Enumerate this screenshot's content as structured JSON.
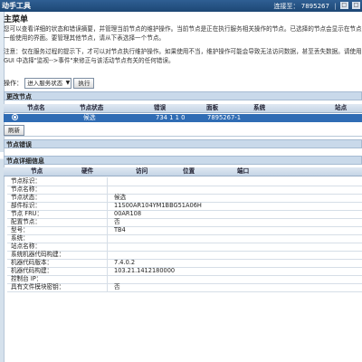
{
  "header": {
    "title_fragment": "动手工具",
    "connection_label": "连接至：",
    "connection_id": "7895267",
    "separator": "|",
    "window_buttons": [
      "□",
      "□"
    ]
  },
  "main_menu": {
    "title": "主菜单",
    "description": "您可以查看详细的状态和错误摘要，并管理当前节点的维护操作。当前节点是正在执行服务相关操作的节点。已选择的节点会显示在节点一般使用的界面。要管理其他节点，请从下表选择一个节点。",
    "note": "注意：仅在服务过程的提示下，才可以对节点执行维护操作。如果使用不当，维护操作可能会导致无法访问数据，甚至丢失数据。请使用 GUI 中选择\"监视-->事件\"来修正与该活动节点有关的任何错误。"
  },
  "operation": {
    "label": "操作：",
    "selected": "进入服务状态",
    "execute_label": "执行"
  },
  "change_node": {
    "title": "更改节点",
    "columns": [
      "节点名",
      "节点状态",
      "错误",
      "面板",
      "系统",
      "站点"
    ],
    "selected_row": {
      "name": "",
      "status": "候选",
      "error": "734 1 1 0",
      "panel": "7895267-1",
      "system": "",
      "site": ""
    },
    "refresh_label": "刷新"
  },
  "node_error": {
    "title": "节点错误"
  },
  "node_details": {
    "title": "节点详细信息",
    "port_columns": [
      "节点",
      "硬件",
      "访问",
      "位置",
      "端口"
    ],
    "properties": [
      {
        "key": "节点标识：",
        "value": ""
      },
      {
        "key": "节点名称：",
        "value": ""
      },
      {
        "key": "节点状态：",
        "value": "候选"
      },
      {
        "key": "部件标识：",
        "value": "11S00AR104YM1BBG51A06H"
      },
      {
        "key": "节点 FRU：",
        "value": "00AR108"
      },
      {
        "key": "配置节点：",
        "value": "否"
      },
      {
        "key": "型号：",
        "value": "TB4"
      },
      {
        "key": "系统：",
        "value": ""
      },
      {
        "key": "站点名称：",
        "value": ""
      },
      {
        "key": "系统机器代码构建：",
        "value": ""
      },
      {
        "key": "机器代码版本：",
        "value": "7.4.0.2"
      },
      {
        "key": "机器代码构建：",
        "value": "103.21.1412180000"
      },
      {
        "key": "控制台 IP：",
        "value": ""
      },
      {
        "key": "具有文件模块密钥：",
        "value": "否"
      }
    ]
  }
}
